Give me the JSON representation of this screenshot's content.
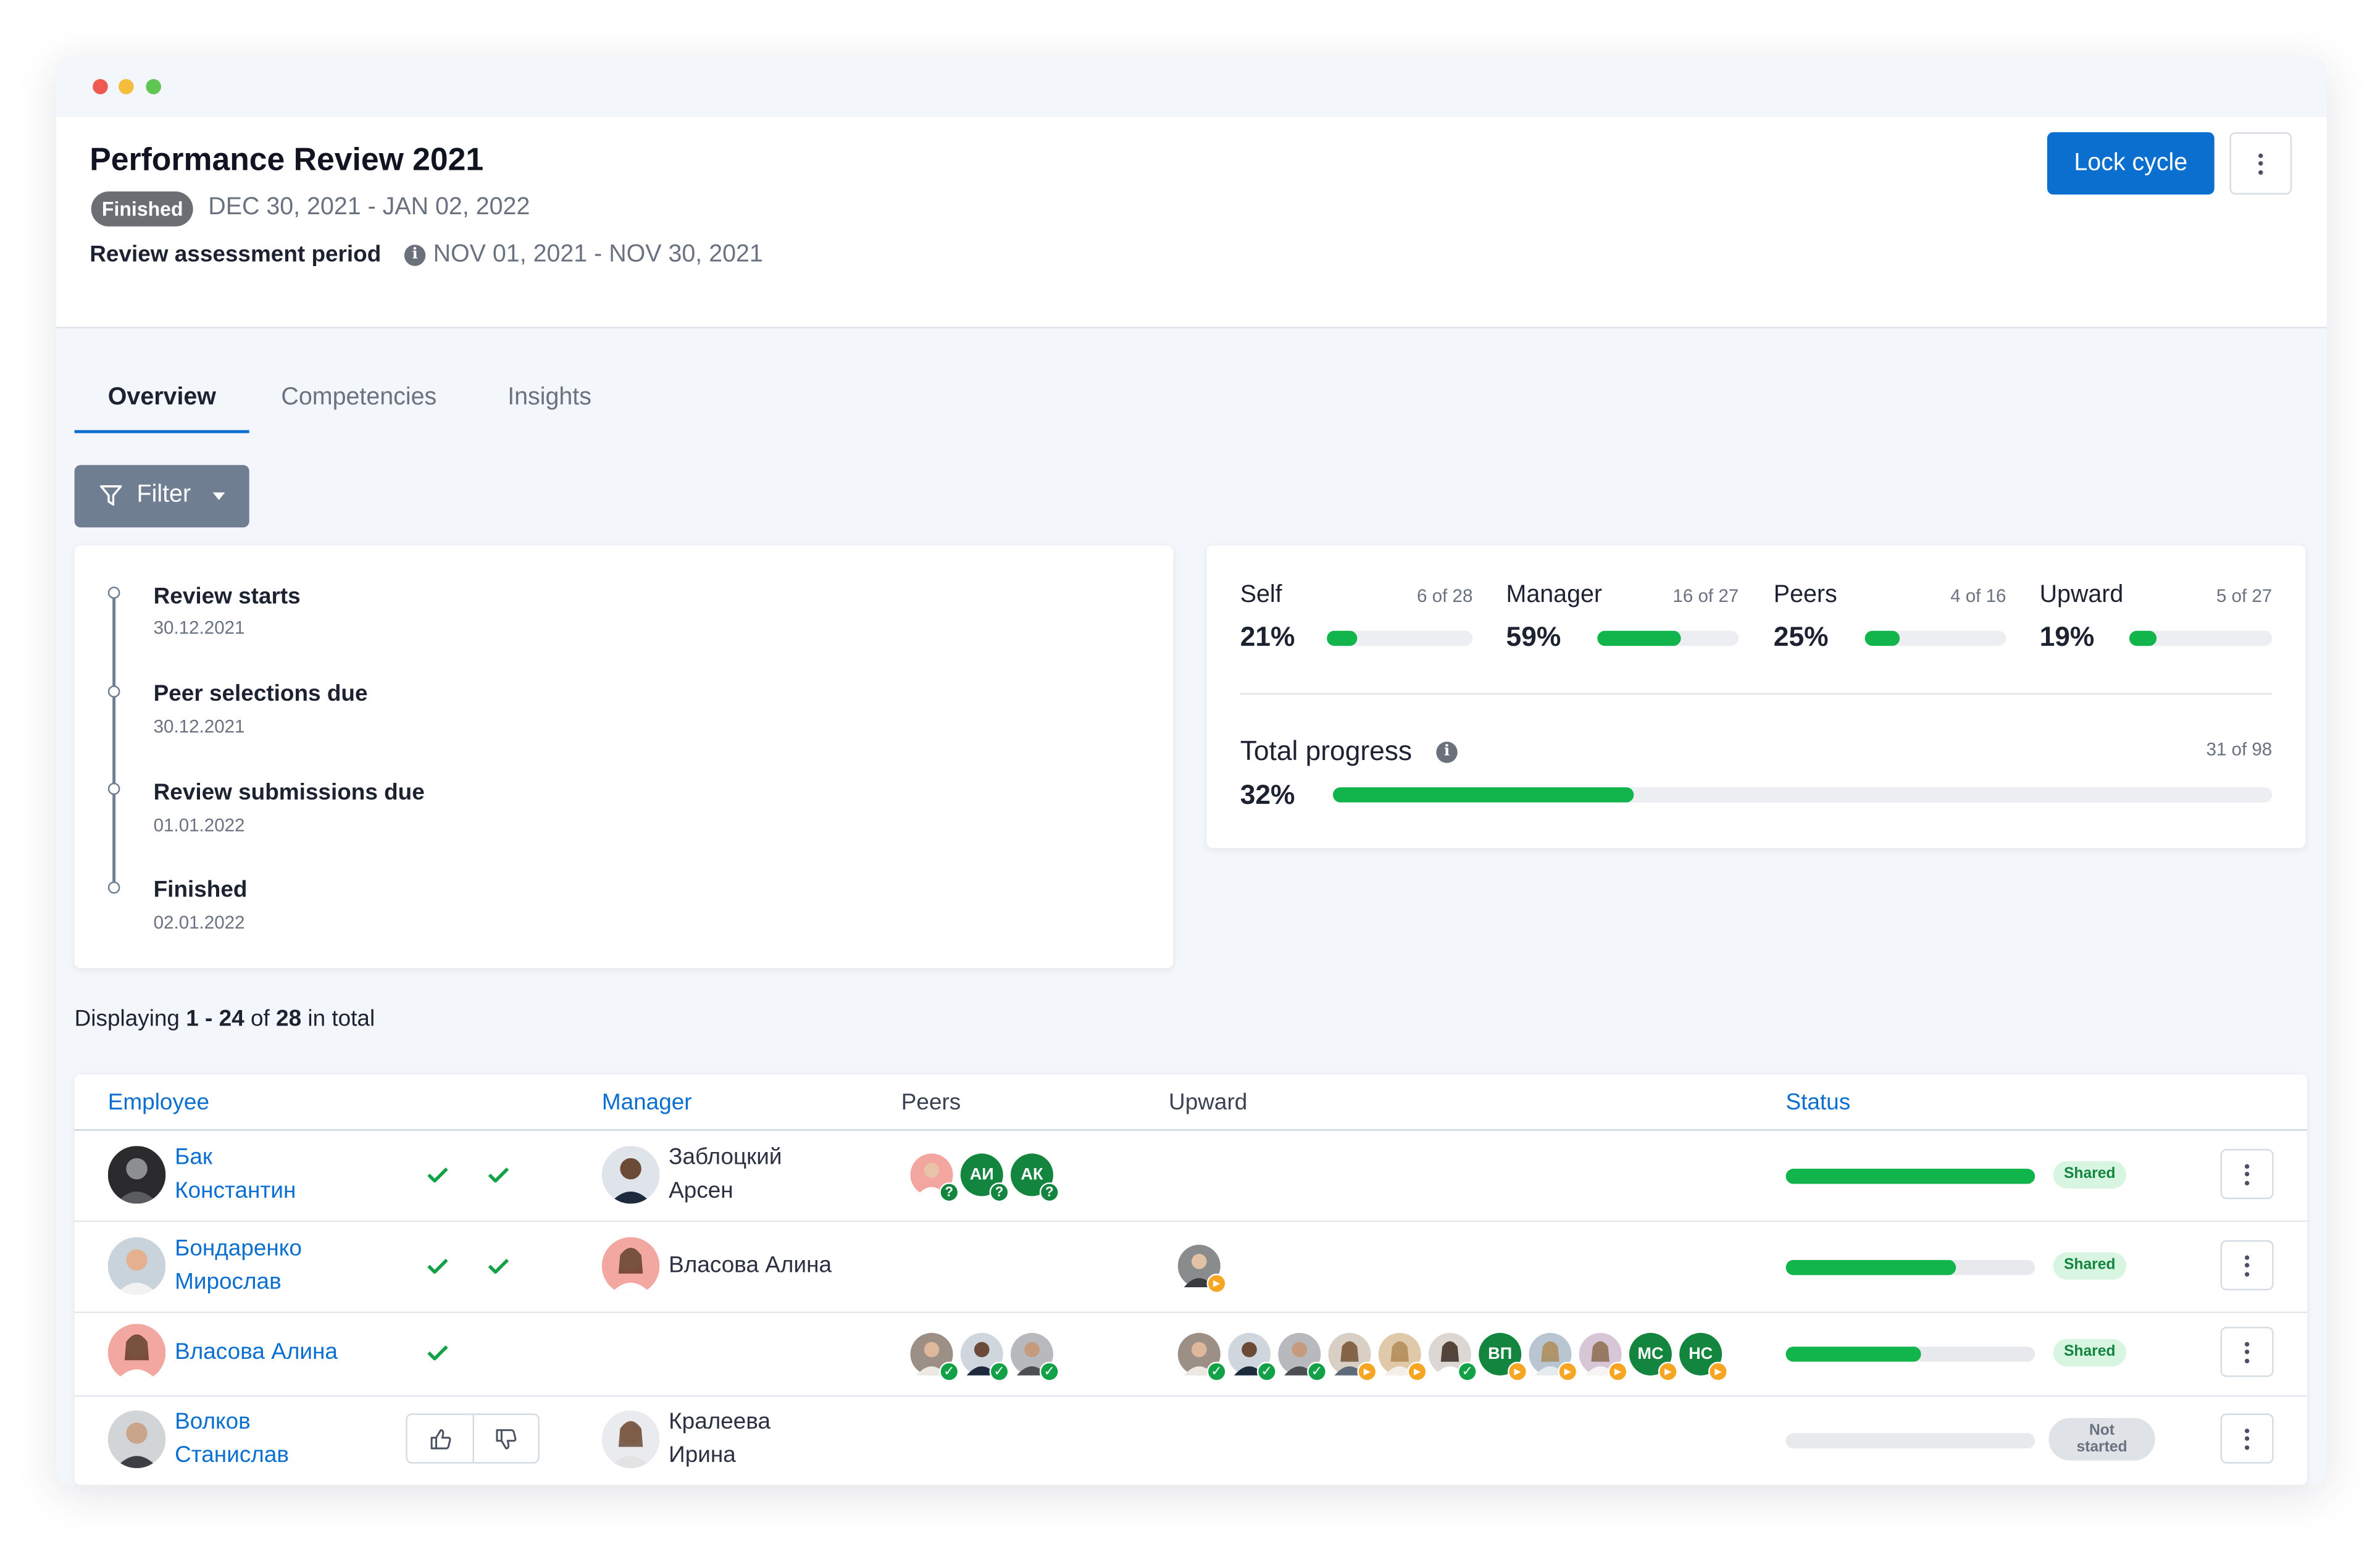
{
  "header": {
    "title": "Performance Review 2021",
    "status": "Finished",
    "cycle_dates": "DEC 30, 2021 - JAN 02, 2022",
    "period_label": "Review assessment period",
    "period_dates": "NOV 01, 2021 - NOV 30, 2021",
    "lock_button": "Lock cycle"
  },
  "tabs": [
    {
      "label": "Overview",
      "active": true
    },
    {
      "label": "Competencies",
      "active": false
    },
    {
      "label": "Insights",
      "active": false
    }
  ],
  "filter": {
    "label": "Filter"
  },
  "timeline": [
    {
      "title": "Review starts",
      "date": "30.12.2021"
    },
    {
      "title": "Peer selections due",
      "date": "30.12.2021"
    },
    {
      "title": "Review submissions due",
      "date": "01.01.2022"
    },
    {
      "title": "Finished",
      "date": "02.01.2022"
    }
  ],
  "progress": {
    "categories": [
      {
        "name": "Self",
        "count": "6 of 28",
        "percent": "21%",
        "value": 0.21
      },
      {
        "name": "Manager",
        "count": "16 of 27",
        "percent": "59%",
        "value": 0.59
      },
      {
        "name": "Peers",
        "count": "4 of 16",
        "percent": "25%",
        "value": 0.25
      },
      {
        "name": "Upward",
        "count": "5 of 27",
        "percent": "19%",
        "value": 0.19
      }
    ],
    "total": {
      "label": "Total progress",
      "count": "31 of 98",
      "percent": "32%",
      "value": 0.32
    }
  },
  "displaying": {
    "prefix": "Displaying",
    "range": "1 - 24",
    "of": "of",
    "total": "28",
    "suffix": "in total"
  },
  "table": {
    "columns": [
      "Employee",
      "Manager",
      "Peers",
      "Upward",
      "Status"
    ],
    "rows": [
      {
        "employee_first": "Бак",
        "employee_last": "Константин",
        "manager_first": "Заблоцкий",
        "manager_last": "Арсен",
        "peers": [
          "АИ",
          "АК"
        ],
        "status_value": 1.0,
        "status_label": "Shared"
      },
      {
        "employee_first": "Бондаренко",
        "employee_last": "Мирослав",
        "manager": "Власова Алина",
        "status_value": 0.68,
        "status_label": "Shared"
      },
      {
        "employee": "Власова Алина",
        "upward_initials": [
          "ВП",
          "МС",
          "НС"
        ],
        "status_value": 0.54,
        "status_label": "Shared"
      },
      {
        "employee_first": "Волков",
        "employee_last": "Станислав",
        "manager_first": "Кралеева",
        "manager_last": "Ирина",
        "status_value": 0.0,
        "status_label_line1": "Not",
        "status_label_line2": "started"
      }
    ]
  },
  "colors": {
    "accent": "#0b6fd0",
    "progress_green": "#12b54c",
    "finished_pill": "#6b6f74",
    "filter_button": "#6f7e91",
    "shared_bg": "#d7f5e1",
    "badge_pending": "#f6a623"
  },
  "icons": [
    "info-icon",
    "filter-icon",
    "more-vertical-icon",
    "check-icon",
    "thumbs-up-icon",
    "thumbs-down-icon",
    "question-badge-icon",
    "play-badge-icon"
  ]
}
